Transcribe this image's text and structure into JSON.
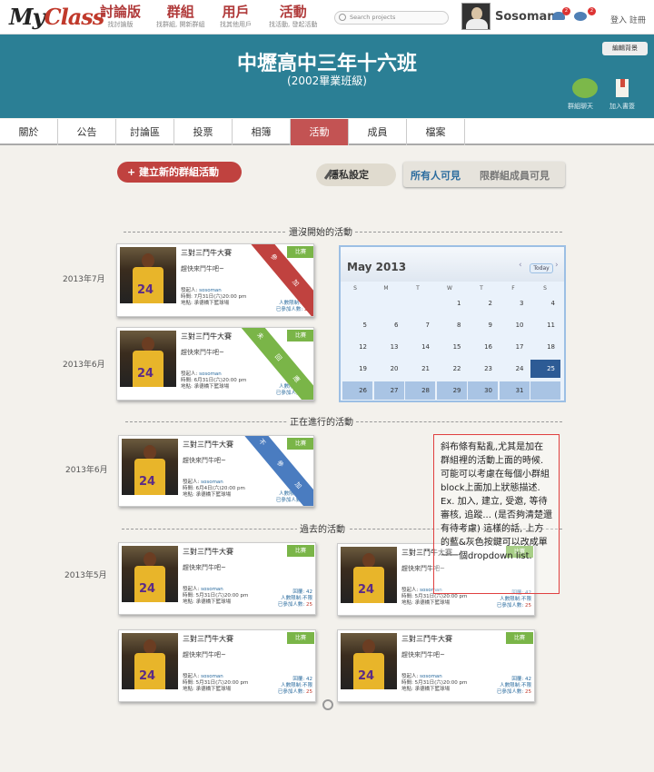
{
  "nav": {
    "logo_my": "My",
    "logo_class": "Class",
    "items": [
      {
        "main": "討論版",
        "sub": "找討論版"
      },
      {
        "main": "群組",
        "sub": "找群組, 開新群組"
      },
      {
        "main": "用戶",
        "sub": "找其他用戶"
      },
      {
        "main": "活動",
        "sub": "找活動, 發起活動"
      }
    ],
    "search_placeholder": "Search projects",
    "username": "Sosoman",
    "badge1": "2",
    "badge2": "2",
    "login": "登入 註冊"
  },
  "banner": {
    "title": "中壢高中三年十六班",
    "subtitle": "(2002畢業班級)",
    "edit_bg": "編輯背景",
    "chat_label": "群組聊天",
    "book_label": "加入書簽"
  },
  "tabs": [
    "關於",
    "公告",
    "討論區",
    "投票",
    "相簿",
    "活動",
    "成員",
    "檔案"
  ],
  "controls": {
    "new_activity": "建立新的群組活動",
    "privacy": "隱私設定",
    "visible_all": "所有人可見",
    "visible_group": "限群組成員可見"
  },
  "sections": {
    "not_started": "還沒開始的活動",
    "ongoing": "正在進行的活動",
    "past": "過去的活動"
  },
  "dates": {
    "d1": "2013年7月",
    "d2": "2013年6月",
    "d3": "2013年6月",
    "d4": "2013年5月"
  },
  "cards": [
    {
      "title": "三對三鬥牛大賽",
      "desc": "趕快來鬥牛吧~",
      "tag": "比賽",
      "organizer_label": "發起人: ",
      "organizer": "sosoman",
      "time": "時間: 7月31日(六)20:00 pm",
      "place": "地點: 承德橋下籃球場",
      "limit": "人數限制:不限",
      "joined_label": "已參加人數: ",
      "joined": "25",
      "ribbon": "參加"
    },
    {
      "title": "三對三鬥牛大賽",
      "desc": "趕快來鬥牛吧~",
      "tag": "比賽",
      "organizer_label": "發起人: ",
      "organizer": "sosoman",
      "time": "時間: 6月31日(六)20:00 pm",
      "place": "地點: 承德橋下籃球場",
      "limit": "人數限制:不限",
      "joined_label": "已參加人數: ",
      "joined": "25",
      "ribbon": "未回應"
    },
    {
      "title": "三對三鬥牛大賽",
      "desc": "趕快來鬥牛吧~",
      "tag": "比賽",
      "organizer_label": "發起人: ",
      "organizer": "sosoman",
      "time": "時間: 6月4日(六)20:00 pm",
      "place": "地點: 承德橋下籃球場",
      "limit": "人數限制:不限",
      "joined_label": "已參加人數: ",
      "joined": "25",
      "ribbon": "不參加"
    },
    {
      "title": "三對三鬥牛大賽",
      "desc": "趕快來鬥牛吧~",
      "tag": "比賽",
      "organizer_label": "發起人: ",
      "organizer": "sosoman",
      "time": "時間: 5月31日(六)20:00 pm",
      "place": "地點: 承德橋下籃球場",
      "reply": "回覆: 42",
      "limit": "人數限制:不限",
      "joined_label": "已參加人數: ",
      "joined": "25"
    },
    {
      "title": "三對三鬥牛大賽",
      "desc": "趕快來鬥牛吧~",
      "tag": "比賽",
      "organizer_label": "發起人: ",
      "organizer": "sosoman",
      "time": "時間: 5月31日(六)20:00 pm",
      "place": "地點: 承德橋下籃球場",
      "reply": "回覆: 42",
      "limit": "人數限制:不限",
      "joined_label": "已參加人數: ",
      "joined": "25"
    },
    {
      "title": "三對三鬥牛大賽",
      "desc": "趕快來鬥牛吧~",
      "tag": "比賽",
      "organizer_label": "發起人: ",
      "organizer": "sosoman",
      "time": "時間: 5月31日(六)20:00 pm",
      "place": "地點: 承德橋下籃球場",
      "reply": "回覆: 42",
      "limit": "人數限制:不限",
      "joined_label": "已參加人數: ",
      "joined": "25"
    },
    {
      "title": "三對三鬥牛大賽",
      "desc": "趕快來鬥牛吧~",
      "tag": "比賽",
      "organizer_label": "發起人: ",
      "organizer": "sosoman",
      "time": "時間: 5月31日(六)20:00 pm",
      "place": "地點: 承德橋下籃球場",
      "reply": "回覆: 42",
      "limit": "人數限制:不限",
      "joined_label": "已參加人數: ",
      "joined": "25"
    }
  ],
  "calendar": {
    "month": "May 2013",
    "today": "Today",
    "dow": [
      "S",
      "M",
      "T",
      "W",
      "T",
      "F",
      "S"
    ],
    "rows": [
      [
        "",
        "",
        "",
        "1",
        "2",
        "3",
        "4"
      ],
      [
        "5",
        "6",
        "7",
        "8",
        "9",
        "10",
        "11"
      ],
      [
        "12",
        "13",
        "14",
        "15",
        "16",
        "17",
        "18"
      ],
      [
        "19",
        "20",
        "21",
        "22",
        "23",
        "24",
        "25"
      ],
      [
        "26",
        "27",
        "28",
        "29",
        "30",
        "31",
        ""
      ]
    ],
    "selected": "25"
  },
  "note": "斜布條有點亂,尤其是加在群組裡的活動上面的時候. 可能可以考慮在每個小群組block上面加上狀態描述. Ex. 加入, 建立, 受邀, 等待審核, 追蹤... (是否夠清楚還有待考慮) 這樣的話, 上方的藍&灰色按鍵可以改成單一一個dropdown list.",
  "colors": {
    "accent": "#c0423f",
    "banner": "#2b7f95",
    "tag": "#7ab548",
    "ribbon_red": "#c0423f",
    "ribbon_green": "#7ab548",
    "ribbon_blue": "#4a7cc0"
  }
}
